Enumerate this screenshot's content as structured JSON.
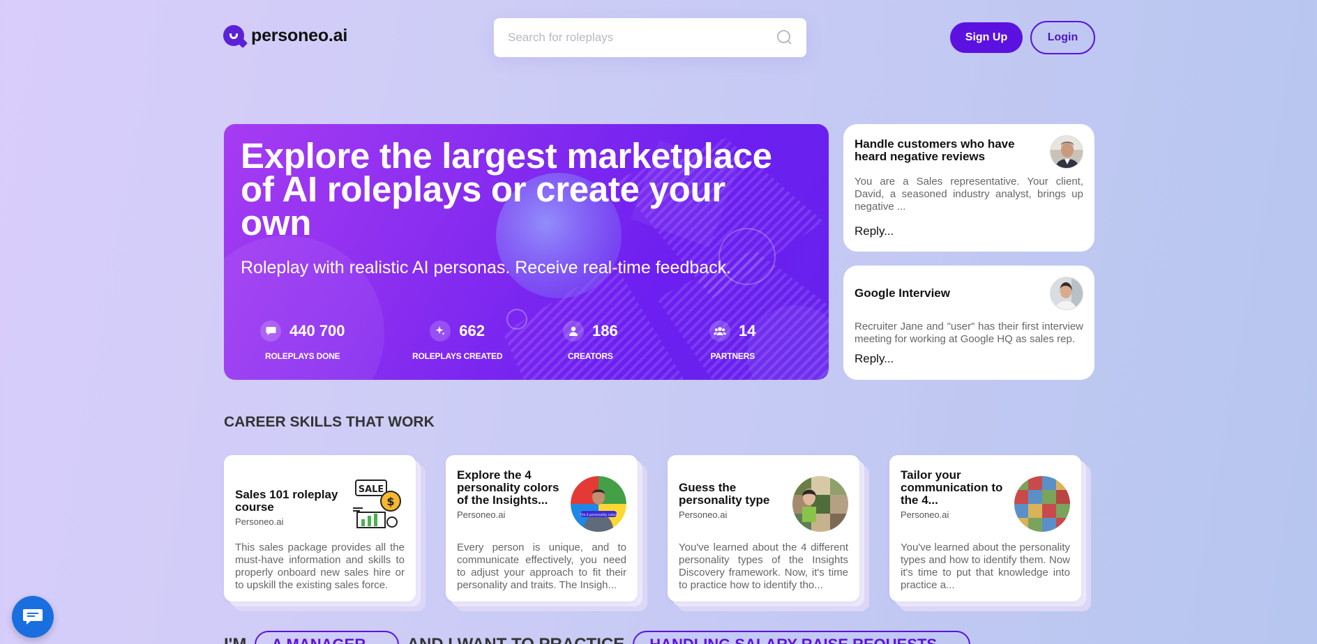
{
  "header": {
    "brand": "personeo.ai",
    "search_placeholder": "Search for roleplays",
    "signup_label": "Sign Up",
    "login_label": "Login"
  },
  "hero": {
    "title": "Explore the largest marketplace of AI roleplays or create your own",
    "subtitle": "Roleplay with realistic AI personas. Receive real-time feedback.",
    "stats": [
      {
        "icon": "chat-icon",
        "value": "440 700",
        "label": "ROLEPLAYS DONE"
      },
      {
        "icon": "sparkle-icon",
        "value": "662",
        "label": "ROLEPLAYS CREATED"
      },
      {
        "icon": "person-icon",
        "value": "186",
        "label": "CREATORS"
      },
      {
        "icon": "group-icon",
        "value": "14",
        "label": "PARTNERS"
      }
    ]
  },
  "roleplays": [
    {
      "title": "Handle customers who have heard negative reviews",
      "description": "You are a Sales representative. Your client, David, a seasoned industry analyst, brings up negative ...",
      "reply": "Reply..."
    },
    {
      "title": "Google Interview",
      "description": "Recruiter Jane and \"user\" has their first interview meeting for working at Google HQ as sales rep.",
      "reply": "Reply..."
    }
  ],
  "section": {
    "title": "CAREER SKILLS THAT WORK"
  },
  "courses": [
    {
      "title": "Sales 101 roleplay course",
      "author": "Personeo.ai",
      "description": "This sales package provides all the must-have information and skills to properly onboard new sales hire or to upskill the existing sales force.",
      "image": "sale-illustration-icon"
    },
    {
      "title": "Explore the 4 personality colors of the Insights...",
      "author": "Personeo.ai",
      "description": "Every person is unique, and to communicate effectively, you need to adjust your approach to fit their personality and traits. The Insigh...",
      "image": "personality-colors-image",
      "image_caption": "The 4 personality colors"
    },
    {
      "title": "Guess the personality type",
      "author": "Personeo.ai",
      "description": "You've learned about the 4 different personality types of the Insights Discovery framework. Now, it's time to practice how to identify tho...",
      "image": "personality-collage-image"
    },
    {
      "title": "Tailor your communication to the 4...",
      "author": "Personeo.ai",
      "description": "You've learned about the personality types and how to identify them. Now it's time to put that knowledge into practice a...",
      "image": "communication-collage-image"
    }
  ],
  "bottom": {
    "prefix": "I'M",
    "role_option": "A MANAGER",
    "middle": "AND I WANT TO PRACTICE",
    "topic_option": "HANDLING SALARY RAISE REQUESTS"
  },
  "colors": {
    "accent": "#5b12e0",
    "hero_start": "#a63cf2",
    "hero_end": "#6622ec",
    "chat_bubble": "#1a6fe0"
  }
}
